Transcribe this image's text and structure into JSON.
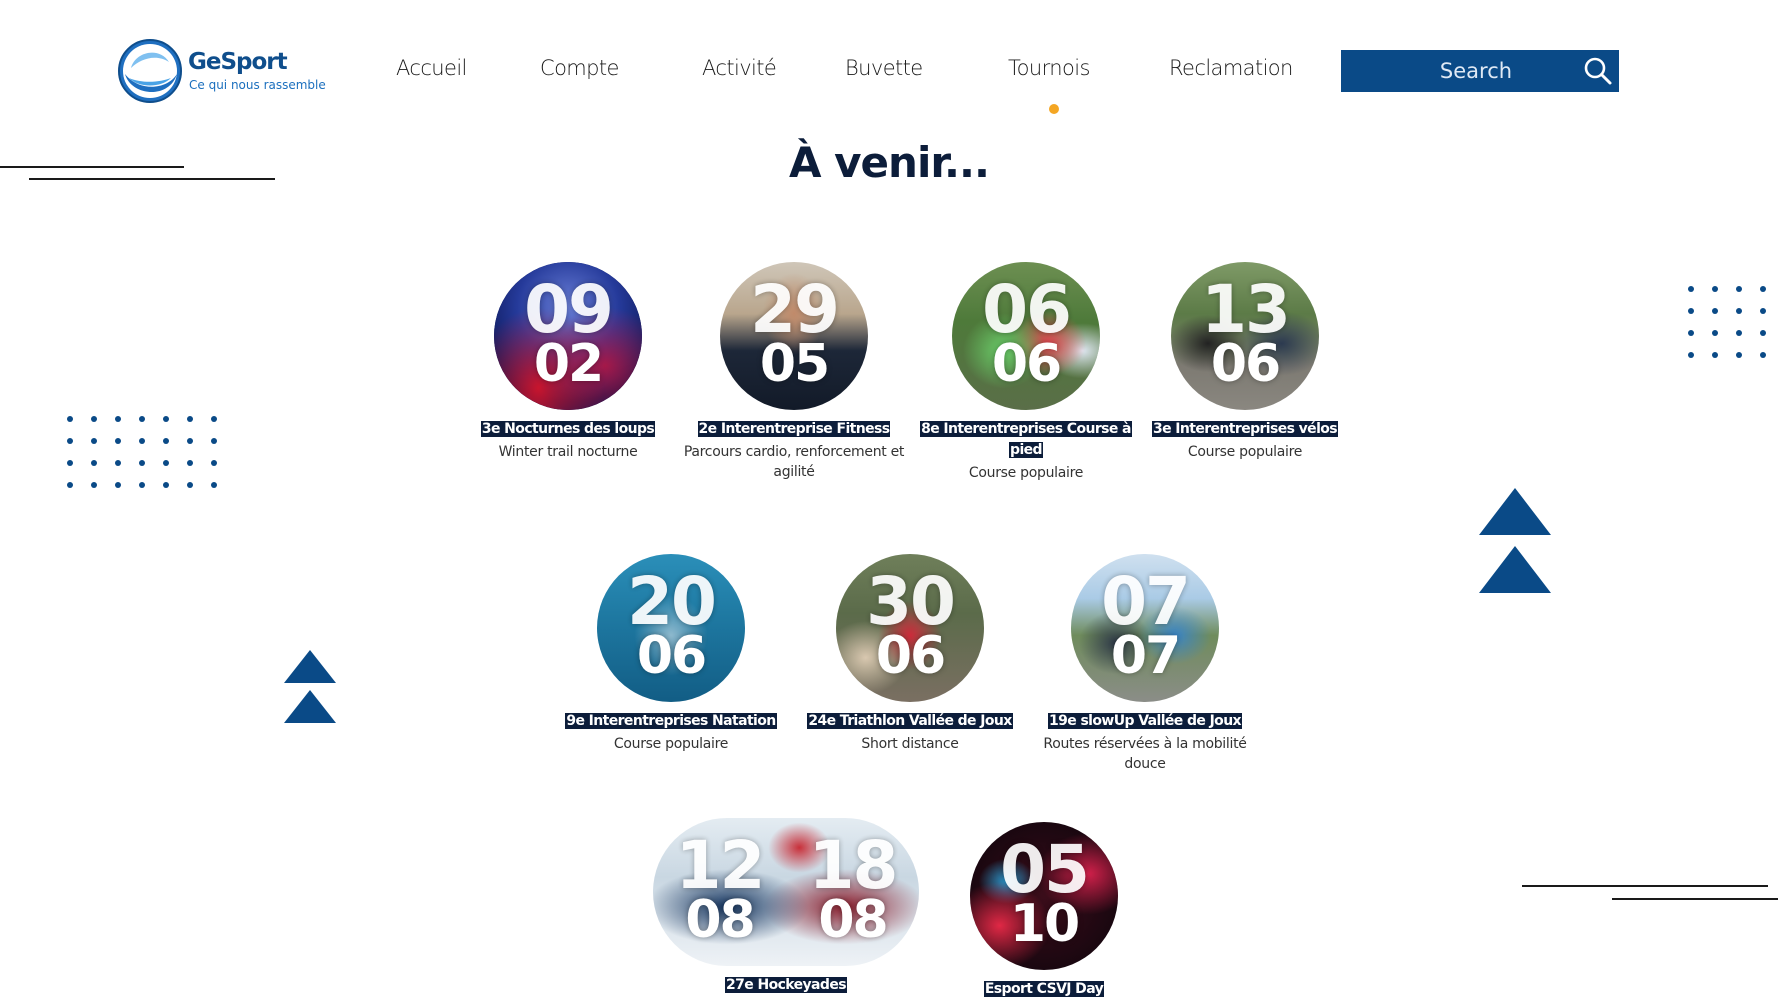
{
  "brand": {
    "name_bold": "GeSport",
    "tagline": "Ce qui nous rassemble",
    "color": "#0f4e8c"
  },
  "nav": {
    "items": [
      "Accueil",
      "Compte",
      "Activité",
      "Buvette",
      "Tournois",
      "Reclamation"
    ],
    "active": "Tournois",
    "active_indicator_color": "#f4a623"
  },
  "search": {
    "placeholder": "Search",
    "icon": "search-icon",
    "background": "#0a4a87"
  },
  "page": {
    "heading": "À venir..."
  },
  "events": [
    {
      "day": "09",
      "month": "02",
      "title": "3e Nocturnes des loups",
      "subtitle": "Winter trail nocturne"
    },
    {
      "day": "29",
      "month": "05",
      "title": "2e Interentreprise Fitness",
      "subtitle": "Parcours cardio, renforcement et agilité"
    },
    {
      "day": "06",
      "month": "06",
      "title": "8e Interentreprises Course à pied",
      "subtitle": "Course populaire"
    },
    {
      "day": "13",
      "month": "06",
      "title": "3e Interentreprises vélos",
      "subtitle": "Course populaire"
    },
    {
      "day": "20",
      "month": "06",
      "title": "9e Interentreprises Natation",
      "subtitle": "Course populaire"
    },
    {
      "day": "30",
      "month": "06",
      "title": "24e Triathlon Vallée de Joux",
      "subtitle": "Short distance"
    },
    {
      "day": "07",
      "month": "07",
      "title": "19e slowUp Vallée de Joux",
      "subtitle": "Routes réservées à la mobilité douce"
    },
    {
      "day": "12",
      "month": "08",
      "day2": "18",
      "month2": "08",
      "title": "27e Hockeyades",
      "subtitle": ""
    },
    {
      "day": "05",
      "month": "10",
      "title": "Esport CSVJ Day",
      "subtitle": ""
    }
  ],
  "theme": {
    "accent": "#0a4a87",
    "title_bg": "#0c1d3a"
  }
}
